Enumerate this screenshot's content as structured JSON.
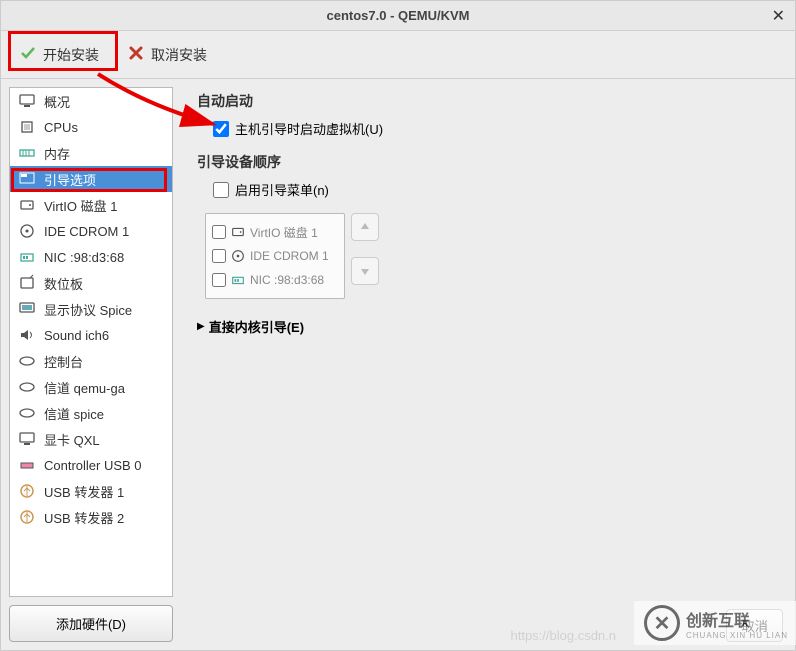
{
  "window": {
    "title": "centos7.0 - QEMU/KVM"
  },
  "toolbar": {
    "begin_install": "开始安装",
    "cancel_install": "取消安装"
  },
  "sidebar": {
    "items": [
      {
        "label": "概况",
        "icon": "monitor"
      },
      {
        "label": "CPUs",
        "icon": "cpu"
      },
      {
        "label": "内存",
        "icon": "memory"
      },
      {
        "label": "引导选项",
        "icon": "boot",
        "selected": true
      },
      {
        "label": "VirtIO 磁盘 1",
        "icon": "disk"
      },
      {
        "label": "IDE CDROM 1",
        "icon": "cdrom"
      },
      {
        "label": "NIC :98:d3:68",
        "icon": "nic"
      },
      {
        "label": "数位板",
        "icon": "tablet"
      },
      {
        "label": "显示协议 Spice",
        "icon": "display"
      },
      {
        "label": "Sound ich6",
        "icon": "sound"
      },
      {
        "label": "控制台",
        "icon": "console"
      },
      {
        "label": "信道 qemu-ga",
        "icon": "channel"
      },
      {
        "label": "信道 spice",
        "icon": "channel"
      },
      {
        "label": "显卡 QXL",
        "icon": "video"
      },
      {
        "label": "Controller USB 0",
        "icon": "usbctrl"
      },
      {
        "label": "USB 转发器 1",
        "icon": "usb"
      },
      {
        "label": "USB 转发器 2",
        "icon": "usb"
      }
    ],
    "add_hardware": "添加硬件(D)"
  },
  "content": {
    "autostart_title": "自动启动",
    "autostart_checkbox_label": "主机引导时启动虚拟机(U)",
    "autostart_checked": true,
    "boot_order_title": "引导设备顺序",
    "enable_boot_menu_label": "启用引导菜单(n)",
    "boot_devices": [
      {
        "label": "VirtIO 磁盘 1",
        "icon": "disk"
      },
      {
        "label": "IDE CDROM 1",
        "icon": "cdrom"
      },
      {
        "label": "NIC :98:d3:68",
        "icon": "nic"
      }
    ],
    "direct_kernel_boot": "直接内核引导(E)",
    "cancel": "取消"
  },
  "watermark": {
    "text": "创新互联",
    "sub": "CHUANG XIN HU LIAN"
  }
}
